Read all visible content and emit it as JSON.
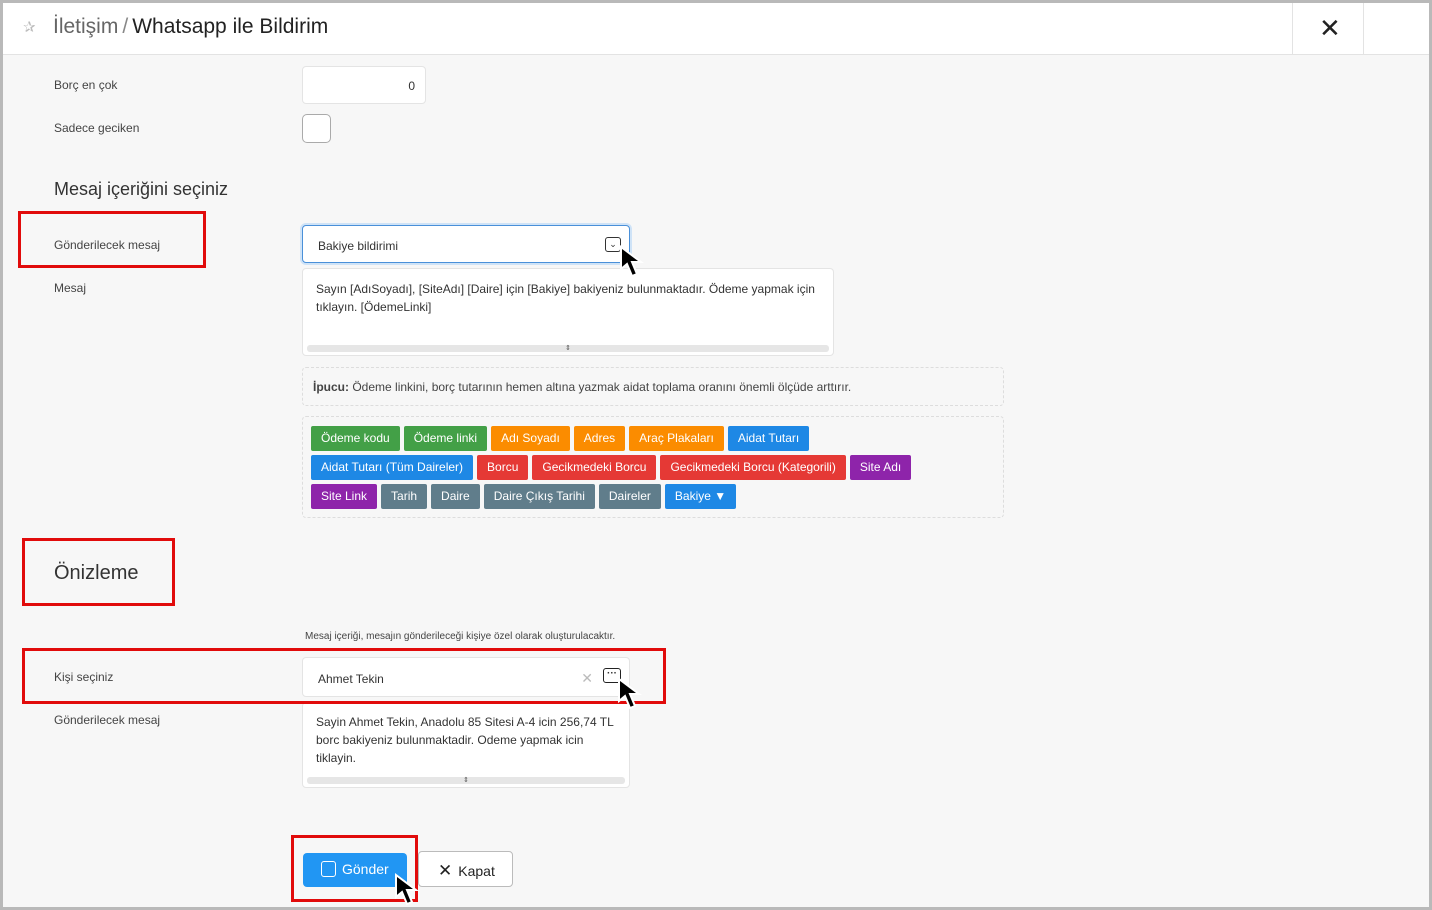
{
  "header": {
    "breadcrumb_parent": "İletişim",
    "separator": "/",
    "title": "Whatsapp ile Bildirim"
  },
  "filters": {
    "debt_max_label": "Borç en çok",
    "debt_max_value": "0",
    "only_late_label": "Sadece geciken",
    "only_late_checked": false
  },
  "message_section": {
    "heading": "Mesaj içeriğini seçiniz",
    "message_to_send_label": "Gönderilecek mesaj",
    "message_to_send_value": "Bakiye bildirimi",
    "message_label": "Mesaj",
    "message_text": "Sayın [AdıSoyadı], [SiteAdı] [Daire] için [Bakiye] bakiyeniz bulunmaktadır. Ödeme yapmak için tıklayın. [ÖdemeLinki]",
    "tip_label": "İpucu:",
    "tip_text": "Ödeme linkini, borç tutarının hemen altına yazmak aidat toplama oranını önemli ölçüde arttırır."
  },
  "tags": [
    [
      {
        "label": "Ödeme kodu",
        "color": "green"
      },
      {
        "label": "Ödeme linki",
        "color": "green"
      },
      {
        "label": "Adı Soyadı",
        "color": "orange"
      },
      {
        "label": "Adres",
        "color": "orange"
      },
      {
        "label": "Araç Plakaları",
        "color": "orange"
      },
      {
        "label": "Aidat Tutarı",
        "color": "blue"
      }
    ],
    [
      {
        "label": "Aidat Tutarı (Tüm Daireler)",
        "color": "blue"
      },
      {
        "label": "Borcu",
        "color": "red"
      },
      {
        "label": "Gecikmedeki Borcu",
        "color": "red"
      },
      {
        "label": "Gecikmedeki Borcu (Kategorili)",
        "color": "red"
      },
      {
        "label": "Site Adı",
        "color": "purple"
      }
    ],
    [
      {
        "label": "Site Link",
        "color": "purple"
      },
      {
        "label": "Tarih",
        "color": "slate"
      },
      {
        "label": "Daire",
        "color": "slate"
      },
      {
        "label": "Daire Çıkış Tarihi",
        "color": "slate"
      },
      {
        "label": "Daireler",
        "color": "slate"
      },
      {
        "label": "Bakiye ▼",
        "color": "blue"
      }
    ]
  ],
  "preview_section": {
    "heading": "Önizleme",
    "note": "Mesaj içeriği, mesajın gönderileceği kişiye özel olarak oluşturulacaktır.",
    "person_label": "Kişi seçiniz",
    "person_value": "Ahmet Tekin",
    "message_to_send_label": "Gönderilecek mesaj",
    "preview_text": "Sayin Ahmet Tekin, Anadolu 85 Sitesi A-4 icin 256,74 TL borc bakiyeniz bulunmaktadir. Odeme yapmak icin tiklayin."
  },
  "actions": {
    "send_label": "Gönder",
    "close_label": "Kapat"
  },
  "colors": {
    "highlight": "#e10b0b",
    "primary": "#2196f3"
  }
}
